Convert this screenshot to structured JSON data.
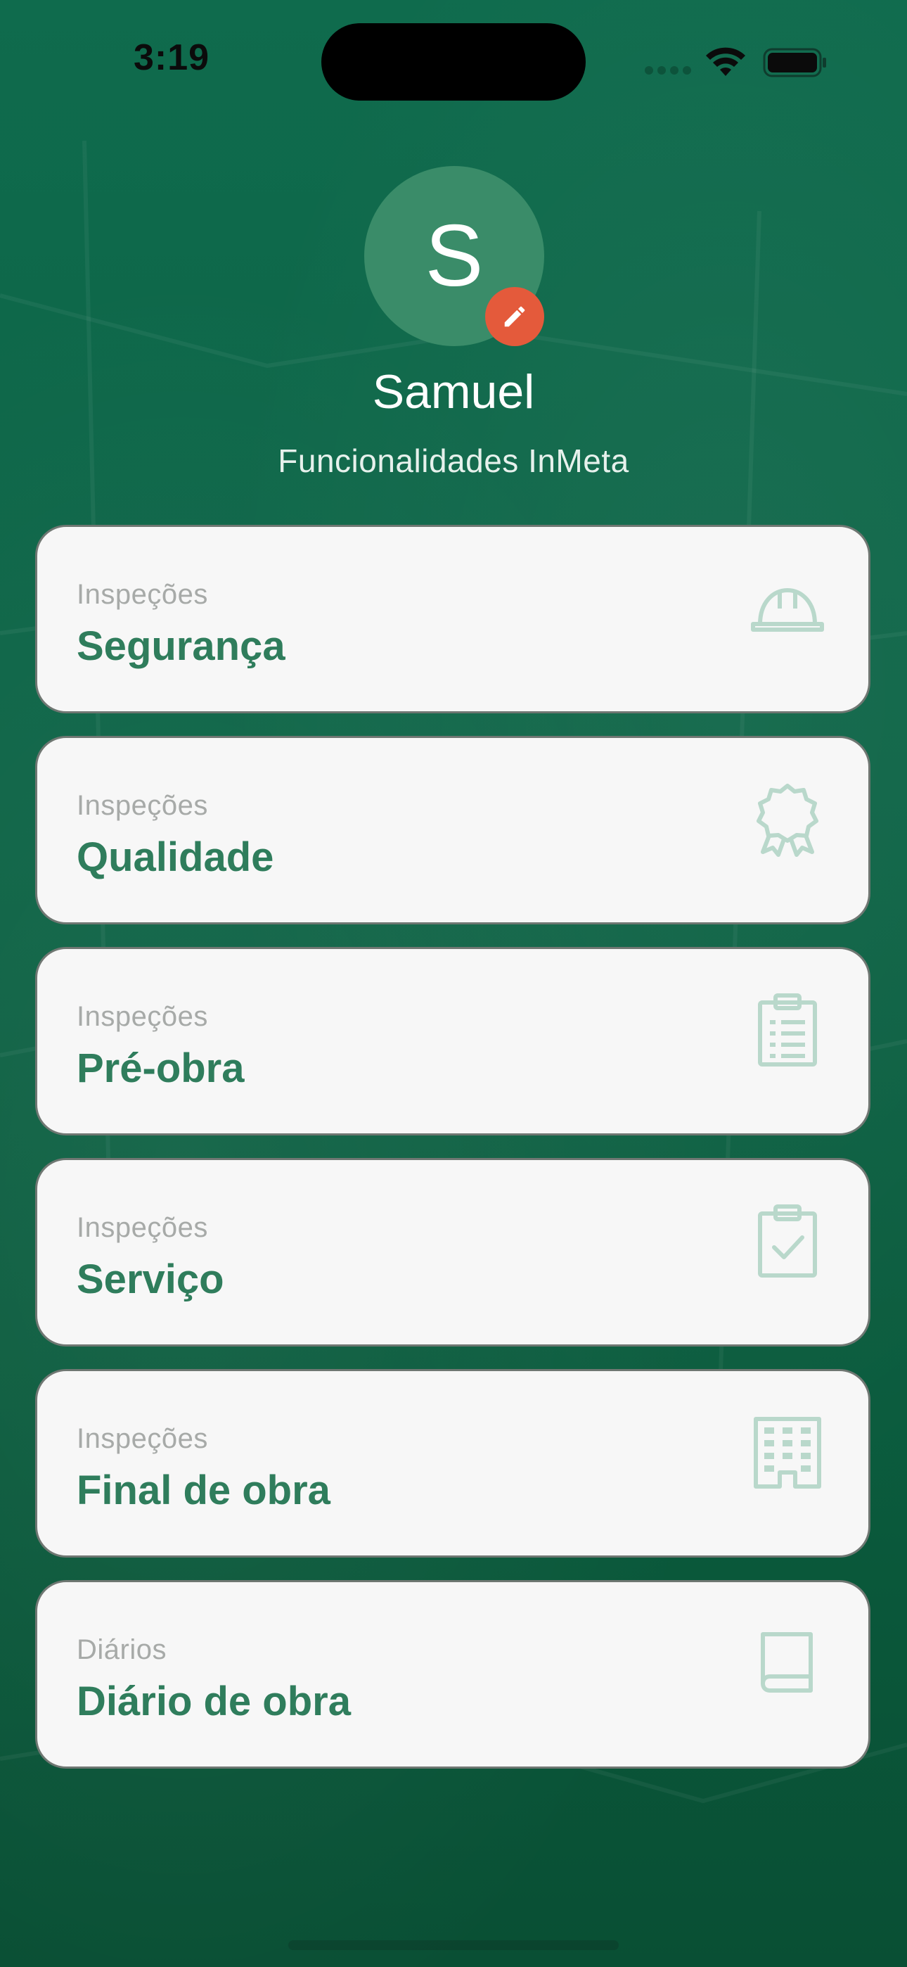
{
  "status_bar": {
    "time": "3:19"
  },
  "profile": {
    "initial": "S",
    "name": "Samuel",
    "subtitle": "Funcionalidades InMeta"
  },
  "menu": [
    {
      "category": "Inspeções",
      "title": "Segurança",
      "icon": "hard-hat-icon"
    },
    {
      "category": "Inspeções",
      "title": "Qualidade",
      "icon": "award-ribbon-icon"
    },
    {
      "category": "Inspeções",
      "title": "Pré-obra",
      "icon": "clipboard-list-icon"
    },
    {
      "category": "Inspeções",
      "title": "Serviço",
      "icon": "clipboard-check-icon"
    },
    {
      "category": "Inspeções",
      "title": "Final de obra",
      "icon": "building-icon"
    },
    {
      "category": "Diários",
      "title": "Diário de obra",
      "icon": "book-icon"
    }
  ],
  "colors": {
    "background": "#0d6446",
    "avatar": "#3a8c69",
    "edit_badge": "#e45a3b",
    "card_title": "#2f7d5c",
    "card_icon": "#b9d8cb"
  }
}
